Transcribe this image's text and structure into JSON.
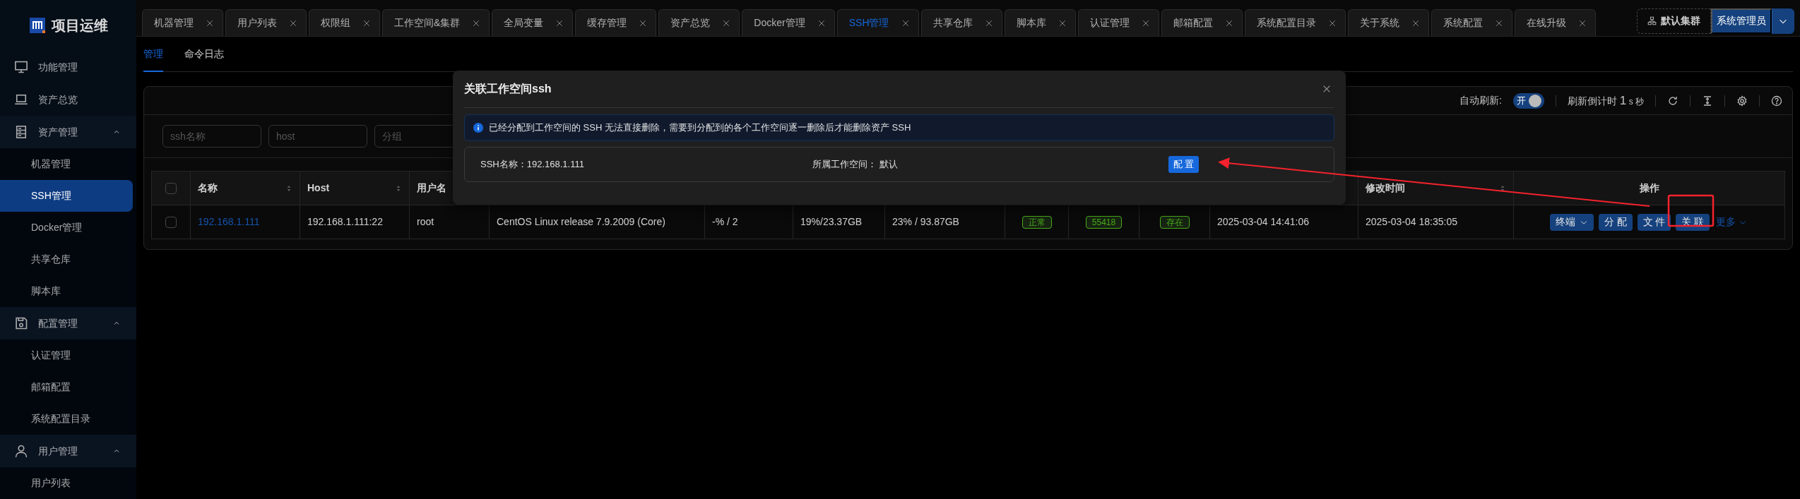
{
  "sidebar": {
    "logo": "项目运维",
    "menu": [
      {
        "label": "功能管理",
        "kind": "item",
        "selected": false
      },
      {
        "label": "资产总览",
        "kind": "item",
        "selected": false
      },
      {
        "label": "资产管理",
        "kind": "group",
        "expanded": true,
        "children": [
          {
            "label": "机器管理",
            "selected": false
          },
          {
            "label": "SSH管理",
            "selected": true
          },
          {
            "label": "Docker管理",
            "selected": false
          },
          {
            "label": "共享仓库",
            "selected": false
          },
          {
            "label": "脚本库",
            "selected": false
          }
        ]
      },
      {
        "label": "配置管理",
        "kind": "group",
        "expanded": true,
        "children": [
          {
            "label": "认证管理",
            "selected": false
          },
          {
            "label": "邮箱配置",
            "selected": false
          },
          {
            "label": "系统配置目录",
            "selected": false
          }
        ]
      },
      {
        "label": "用户管理",
        "kind": "group",
        "expanded": true,
        "children": [
          {
            "label": "用户列表",
            "selected": false
          }
        ]
      }
    ]
  },
  "tabs": [
    {
      "label": "机器管理",
      "selected": false
    },
    {
      "label": "用户列表",
      "selected": false
    },
    {
      "label": "权限组",
      "selected": false
    },
    {
      "label": "工作空间&集群",
      "selected": false
    },
    {
      "label": "全局变量",
      "selected": false
    },
    {
      "label": "缓存管理",
      "selected": false
    },
    {
      "label": "资产总览",
      "selected": false
    },
    {
      "label": "Docker管理",
      "selected": false
    },
    {
      "label": "SSH管理",
      "selected": true
    },
    {
      "label": "共享仓库",
      "selected": false
    },
    {
      "label": "脚本库",
      "selected": false
    },
    {
      "label": "认证管理",
      "selected": false
    },
    {
      "label": "邮箱配置",
      "selected": false
    },
    {
      "label": "系统配置目录",
      "selected": false
    },
    {
      "label": "关于系统",
      "selected": false
    },
    {
      "label": "系统配置",
      "selected": false
    },
    {
      "label": "在线升级",
      "selected": false
    }
  ],
  "header_right": {
    "cluster": "默认集群",
    "user": "系统管理员"
  },
  "subtabs": [
    {
      "label": "管理",
      "selected": true
    },
    {
      "label": "命令日志",
      "selected": false
    }
  ],
  "toolbar": {
    "auto_refresh_label": "自动刷新:",
    "auto_refresh": {
      "on": true,
      "label": "开"
    },
    "countdown": "刷新倒计时",
    "countdown_value": "1",
    "countdown_unit": "s 秒"
  },
  "filters": [
    {
      "placeholder": "ssh名称"
    },
    {
      "placeholder": "host"
    },
    {
      "placeholder": "分组"
    }
  ],
  "table": {
    "header_checked": false,
    "columns_left": [
      {
        "label": "名称",
        "sortable": true
      },
      {
        "label": "Host",
        "sortable": true
      },
      {
        "label": "用户名"
      }
    ],
    "columns_right": [
      {
        "label": "修改时间",
        "sortable": true
      },
      {
        "label": "操作",
        "sortable": false
      }
    ],
    "rows": [
      {
        "checked": false,
        "cells": [
          {
            "kind": "link",
            "text": "192.168.1.111"
          },
          {
            "kind": "text",
            "text": "192.168.1.111:22"
          },
          {
            "kind": "text",
            "text": "root"
          },
          {
            "kind": "text",
            "text": "CentOS Linux release 7.9.2009 (Core)"
          },
          {
            "kind": "text",
            "text": "-% / 2"
          },
          {
            "kind": "text",
            "text": "19%/23.37GB"
          },
          {
            "kind": "text",
            "text": "23% / 93.87GB"
          },
          {
            "kind": "tag",
            "text": "正常",
            "color": "#49aa19"
          },
          {
            "kind": "tag",
            "text": "55418",
            "color": "#49aa19"
          },
          {
            "kind": "tag",
            "text": "存在",
            "color": "#49aa19"
          },
          {
            "kind": "text",
            "text": "2025-03-04 14:41:06"
          },
          {
            "kind": "text",
            "text": "2025-03-04 18:35:05"
          },
          {
            "kind": "actions",
            "actions": [
              {
                "label": "终端",
                "kind": "button",
                "dropdown": true
              },
              {
                "label": "分 配",
                "kind": "button",
                "dropdown": false
              },
              {
                "label": "文 件",
                "kind": "button",
                "dropdown": false
              },
              {
                "label": "关 联",
                "kind": "button",
                "dropdown": false
              },
              {
                "label": "更多",
                "kind": "link",
                "dropdown": true
              }
            ]
          }
        ]
      }
    ]
  },
  "modal": {
    "title": "关联工作空间ssh",
    "alert": "已经分配到工作空间的 SSH 无法直接删除，需要到分配到的各个工作空间逐一删除后才能删除资产 SSH",
    "name": "SSH名称：192.168.1.111",
    "workspace_label": "所属工作空间：",
    "workspace_value": "默认",
    "button": "配 置"
  }
}
